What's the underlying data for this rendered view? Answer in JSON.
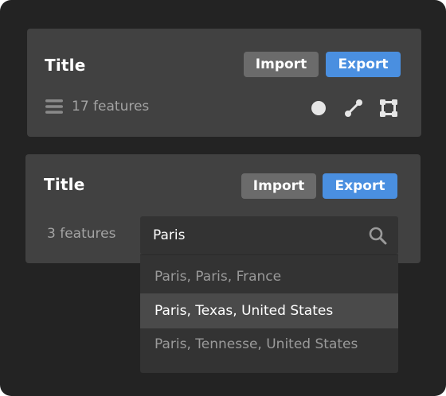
{
  "panels": [
    {
      "title": "Title",
      "import_label": "Import",
      "export_label": "Export",
      "feature_count": "17 features",
      "tools": [
        "point-tool-icon",
        "line-tool-icon",
        "polygon-tool-icon"
      ]
    },
    {
      "title": "Title",
      "import_label": "Import",
      "export_label": "Export",
      "feature_count": "3 features",
      "search": {
        "value": "Paris",
        "results": [
          "Paris, Paris, France",
          "Paris, Texas, United States",
          "Paris, Tennesse, United States"
        ],
        "highlighted_index": 1
      }
    }
  ],
  "colors": {
    "background": "#232323",
    "panel": "#414141",
    "import_button": "#6b6b6b",
    "export_button": "#4a8fe0",
    "search_box": "#333333",
    "highlight": "#4a4a4a"
  }
}
